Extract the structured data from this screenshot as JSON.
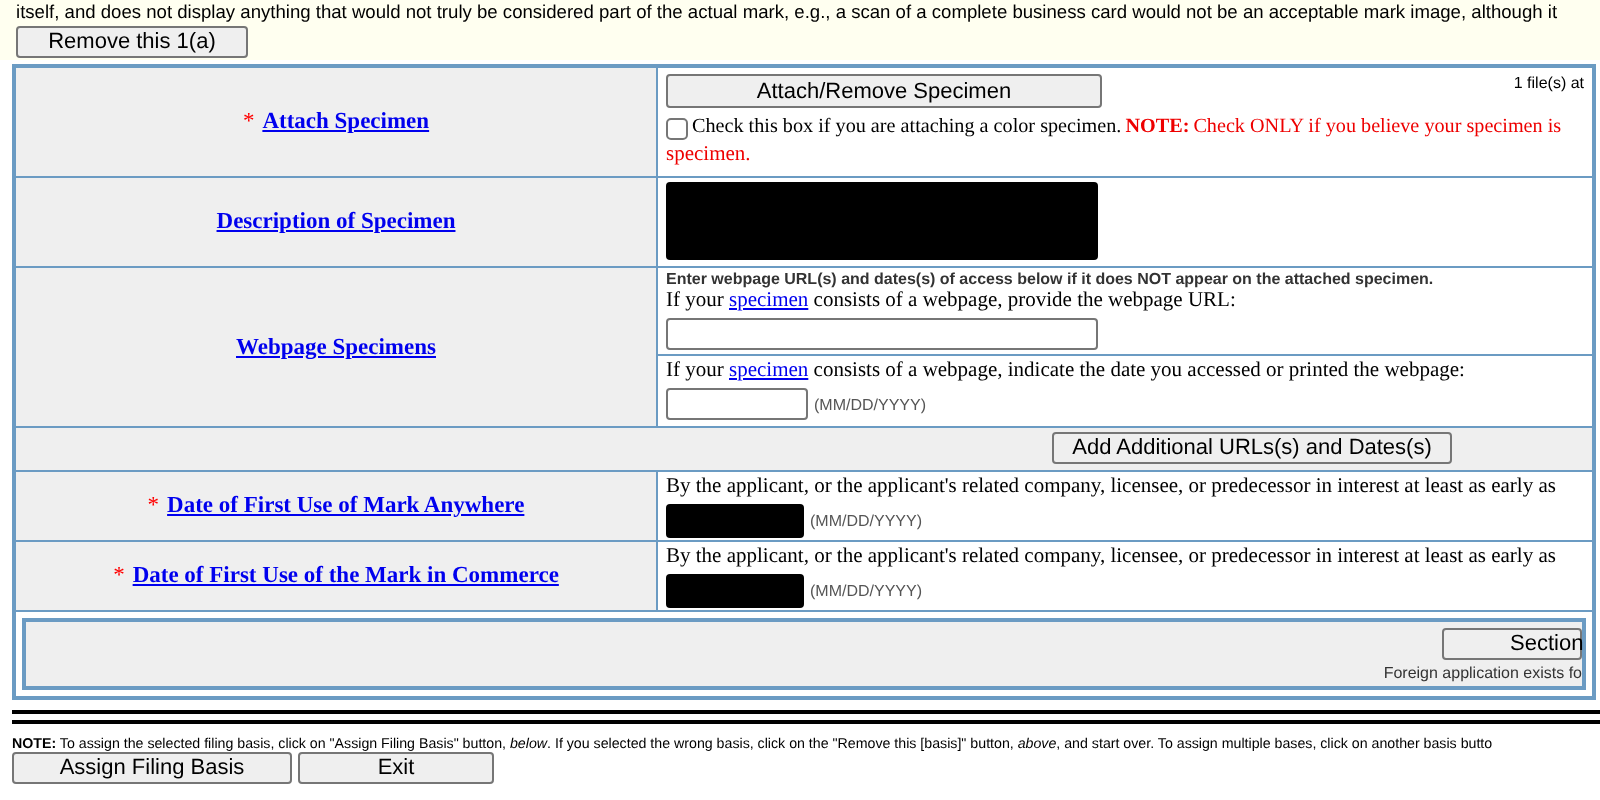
{
  "intro": {
    "text": "itself, and does not display anything that would not truly be considered part of the actual mark, e.g., a scan of a complete business card would not be an acceptable mark image, although it",
    "remove_button": "Remove this 1(a)"
  },
  "rows": [
    {
      "kind": "attach",
      "label": "Attach Specimen",
      "required_mark": "*",
      "button": "Attach/Remove Specimen",
      "file_count": "1 file(s) at",
      "checkbox": {
        "label": "Check this box if you are attaching a color specimen.",
        "checked": false,
        "note_label": "NOTE:",
        "note_text": "Check ONLY if you believe your specimen is",
        "note_more": "specimen."
      }
    },
    {
      "kind": "redacted",
      "label": "Description of Specimen"
    },
    {
      "kind": "webpage",
      "label": "Webpage Specimens",
      "hint": "Enter webpage URL(s) and dates(s) of access below if it does NOT appear on the attached specimen.",
      "url_prefix": "If your",
      "url_link": "specimen",
      "url_suffix": "consists of a webpage, provide the webpage URL:",
      "date_prefix": "If your",
      "date_link": "specimen",
      "date_suffix": "consists of a webpage, indicate the date you accessed or printed the webpage:",
      "date_format": "(MM/DD/YYYY)"
    },
    {
      "kind": "add",
      "button": "Add Additional URLs(s) and Dates(s)"
    },
    {
      "kind": "date",
      "label": "Date of First Use of Mark Anywhere",
      "required_mark": "*",
      "text": "By the applicant, or the applicant's related company, licensee, or predecessor in interest at least as early as",
      "date_format": "(MM/DD/YYYY)"
    },
    {
      "kind": "date",
      "label": "Date of First Use of the Mark in Commerce",
      "required_mark": "*",
      "text": "By the applicant, or the applicant's related company, licensee, or predecessor in interest at least as early as",
      "date_format": "(MM/DD/YYYY)"
    },
    {
      "kind": "section",
      "button": "Section",
      "note": "Foreign application exists fo"
    }
  ],
  "footer": {
    "note_label": "NOTE:",
    "note": "To assign the selected filing basis, click on \"Assign Filing Basis\" button, *below*. If you selected the wrong basis, click on the \"Remove this [basis]\" button, *above*, and start over. To assign multiple bases, click on another basis butto",
    "buttons": [
      "Assign Filing Basis",
      "Exit"
    ]
  }
}
